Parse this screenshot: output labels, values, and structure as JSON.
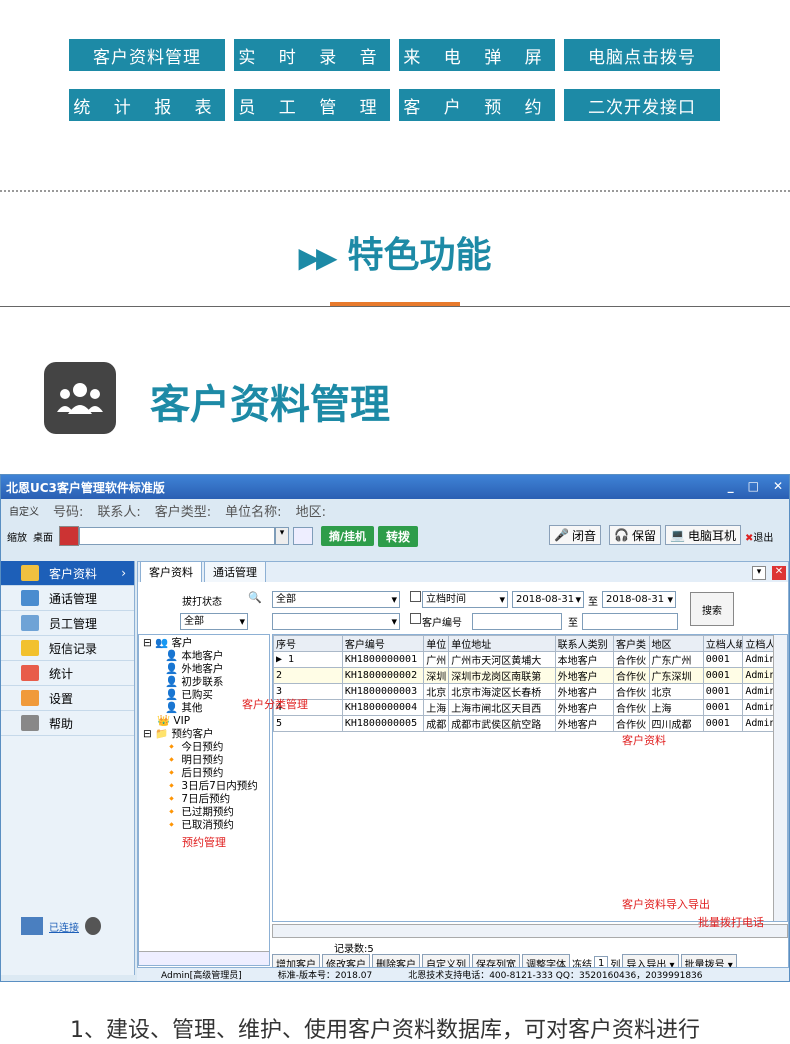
{
  "nav": [
    {
      "label": "客户资料管理"
    },
    {
      "label": "实 时 录 音"
    },
    {
      "label": "来 电 弹 屏"
    },
    {
      "label": "电脑点击拨号"
    },
    {
      "label": "统 计 报 表"
    },
    {
      "label": "员 工 管 理"
    },
    {
      "label": "客 户 预 约"
    },
    {
      "label": "二次开发接口"
    }
  ],
  "feature_title": "特色功能",
  "section_title": "客户资料管理",
  "app": {
    "title": "北恩UC3客户管理软件标准版",
    "fields": {
      "custom": "自定义",
      "phone": "号码:",
      "contact": "联系人:",
      "type": "客户类型:",
      "company": "单位名称:",
      "region": "地区:"
    },
    "toolbar": {
      "minimize": "缩放",
      "desktop": "桌面",
      "answer": "摘/挂机",
      "dial": "转拨",
      "mute": "闭音",
      "hold": "保留",
      "headset": "电脑耳机",
      "exit": "退出"
    },
    "sidebar": [
      {
        "label": "客户资料"
      },
      {
        "label": "通话管理"
      },
      {
        "label": "员工管理"
      },
      {
        "label": "短信记录"
      },
      {
        "label": "统计"
      },
      {
        "label": "设置"
      },
      {
        "label": "帮助"
      }
    ],
    "connected": "已连接",
    "tabs": [
      "客户资料",
      "通话管理"
    ],
    "filters": {
      "dial_status": "拔打状态",
      "all1": "全部",
      "all2": "全部",
      "date_label": "立档时间",
      "date_from": "2018-08-31",
      "to": "至",
      "date_to": "2018-08-31",
      "cust_no": "客户编号",
      "to2": "至",
      "search": "搜索"
    },
    "tree": [
      "客户",
      "本地客户",
      "外地客户",
      "初步联系",
      "已购买",
      "其他",
      "VIP",
      "预约客户",
      "今日预约",
      "明日预约",
      "后日预约",
      "3日后7日内预约",
      "7日后预约",
      "已过期预约",
      "已取消预约"
    ],
    "columns": [
      "序号",
      "客户编号",
      "单位",
      "单位地址",
      "联系人类别",
      "客户类",
      "地区",
      "立档人编号",
      "立档人"
    ],
    "rows": [
      [
        "1",
        "KH1800000001",
        "广州",
        "广州市天河区黄埔大",
        "本地客户",
        "合作伙",
        "广东广州",
        "0001",
        "Admin"
      ],
      [
        "2",
        "KH1800000002",
        "深圳",
        "深圳市龙岗区南联第",
        "外地客户",
        "合作伙",
        "广东深圳",
        "0001",
        "Admin"
      ],
      [
        "3",
        "KH1800000003",
        "北京",
        "北京市海淀区长春桥",
        "外地客户",
        "合作伙",
        "北京",
        "0001",
        "Admin"
      ],
      [
        "4",
        "KH1800000004",
        "上海",
        "上海市闸北区天目西",
        "外地客户",
        "合作伙",
        "上海",
        "0001",
        "Admin"
      ],
      [
        "5",
        "KH1800000005",
        "成都",
        "成都市武侯区航空路",
        "外地客户",
        "合作伙",
        "四川成都",
        "0001",
        "Admin"
      ]
    ],
    "annotations": {
      "category": "客户分类管理",
      "customer": "客户资料",
      "appoint": "预约管理",
      "import": "客户资料导入导出",
      "batch": "批量拨打电话"
    },
    "record_count": "记录数:5",
    "buttons": [
      "增加客户",
      "修改客户",
      "删除客户",
      "自定义列",
      "保存列宽",
      "调整字体",
      "冻结",
      "1",
      "列",
      "导入导出 ▾",
      "批量拨号 ▾"
    ],
    "status": [
      "Admin[高级管理员]",
      "标准-版本号：2018.07",
      "北恩技术支持电话：400-8121-333  QQ：3520160436，2039991836"
    ]
  },
  "bottom_text": "1、建设、管理、维护、使用客户资料数据库，可对客户资料进行"
}
